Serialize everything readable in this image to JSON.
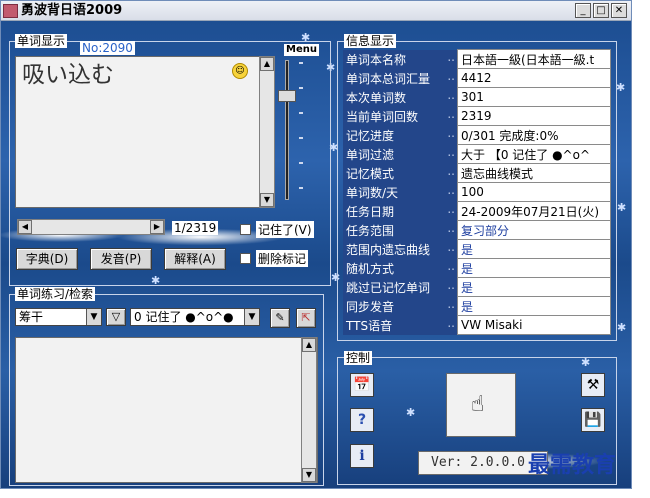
{
  "window": {
    "title": "勇波背日语2009"
  },
  "word_panel": {
    "title": "单词显示",
    "word_no": "No:2090",
    "menu_label": "Menu",
    "word": "吸い込む",
    "position": "1/2319",
    "remember_label": "记住了(V)",
    "remember_checked": false,
    "buttons": {
      "dict": "字典(D)",
      "pronounce": "发音(P)",
      "explain": "解释(A)"
    },
    "delete_mark_label": "删除标记",
    "delete_mark_checked": false
  },
  "info_panel": {
    "title": "信息显示",
    "rows": [
      {
        "key": "单词本名称",
        "value": "日本語一級(日本語一級.t",
        "highlight": false
      },
      {
        "key": "单词本总词汇量",
        "value": "4412"
      },
      {
        "key": "本次单词数",
        "value": "301"
      },
      {
        "key": "当前单词回数",
        "value": "2319"
      },
      {
        "key": "记忆进度",
        "value": "0/301      完成度:0%"
      },
      {
        "key": "单词过滤",
        "value": "大于 【0 记住了  ●^o^"
      },
      {
        "key": "记忆模式",
        "value": "遗忘曲线模式"
      },
      {
        "key": "单词数/天",
        "value": "100",
        "indent": true
      },
      {
        "key": "任务日期",
        "value": "24-2009年07月21日(火)",
        "indent": true
      },
      {
        "key": "任务范围",
        "value": "复习部分",
        "indent": true,
        "blue": true
      },
      {
        "key": "范围内遗忘曲线",
        "value": "是",
        "blue": true
      },
      {
        "key": "随机方式",
        "value": "是",
        "blue": true
      },
      {
        "key": "跳过已记忆单词",
        "value": "是",
        "blue": true
      },
      {
        "key": "同步发音",
        "value": "是",
        "blue": true
      },
      {
        "key": "TTS语音",
        "value": "VW Misaki"
      }
    ]
  },
  "search_panel": {
    "title": "单词练习/检索",
    "combo_value": "筹干",
    "filter_value": "0 记住了  ●^o^●"
  },
  "control_panel": {
    "title": "控制",
    "version": "Ver: 2.0.0.0"
  },
  "watermark": "最需教育",
  "colors": {
    "background": "#1d4e92",
    "info_key_bg": "#23468a",
    "value_blue": "#1e3fa0"
  }
}
